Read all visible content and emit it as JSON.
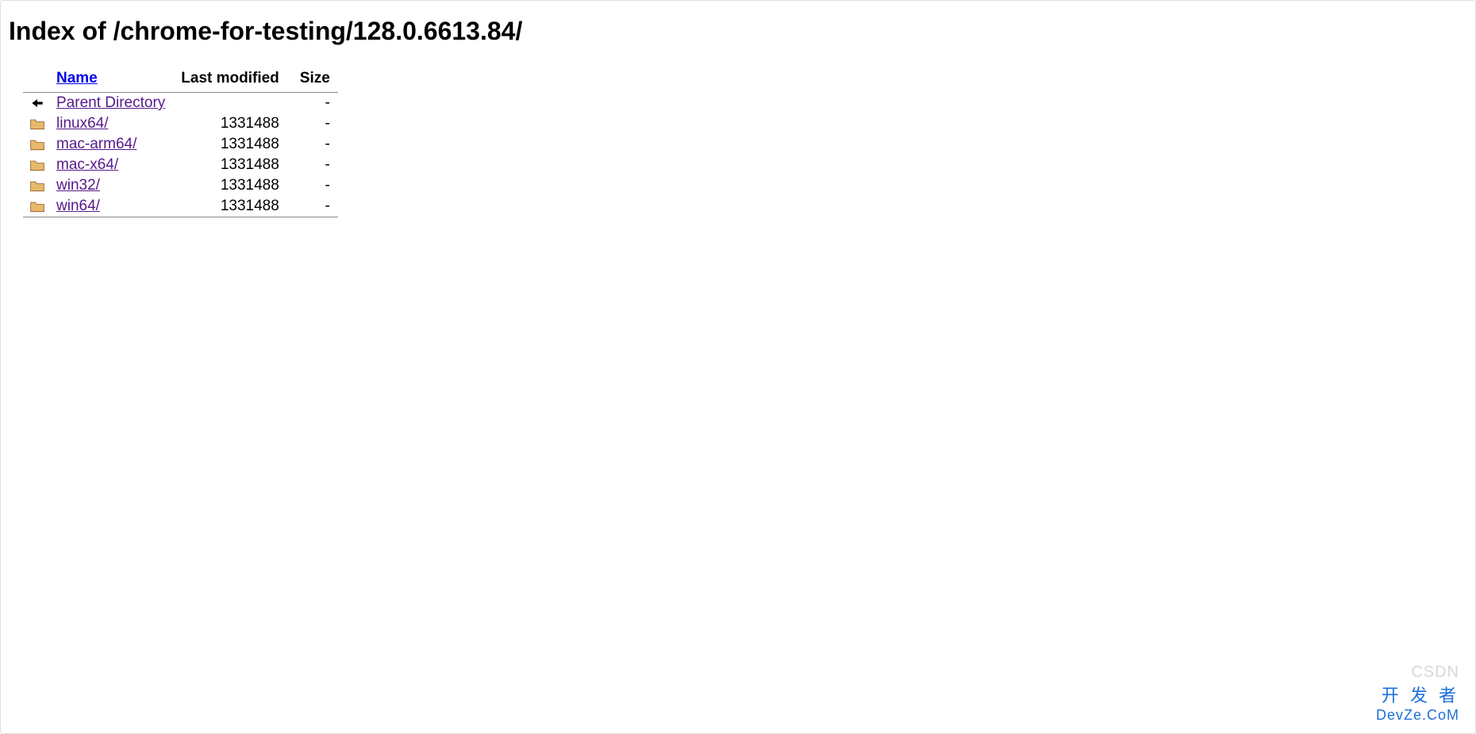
{
  "title": "Index of /chrome-for-testing/128.0.6613.84/",
  "headers": {
    "name": "Name",
    "modified": "Last modified",
    "size": "Size"
  },
  "rows": [
    {
      "icon": "back",
      "name": "Parent Directory",
      "modified": "",
      "size": "-"
    },
    {
      "icon": "folder",
      "name": "linux64/",
      "modified": "1331488",
      "size": "-"
    },
    {
      "icon": "folder",
      "name": "mac-arm64/",
      "modified": "1331488",
      "size": "-"
    },
    {
      "icon": "folder",
      "name": "mac-x64/",
      "modified": "1331488",
      "size": "-"
    },
    {
      "icon": "folder",
      "name": "win32/",
      "modified": "1331488",
      "size": "-"
    },
    {
      "icon": "folder",
      "name": "win64/",
      "modified": "1331488",
      "size": "-"
    }
  ],
  "watermark": {
    "line1": "CSDN",
    "line2": "开 发 者",
    "line3": "DevZe.CoM"
  }
}
